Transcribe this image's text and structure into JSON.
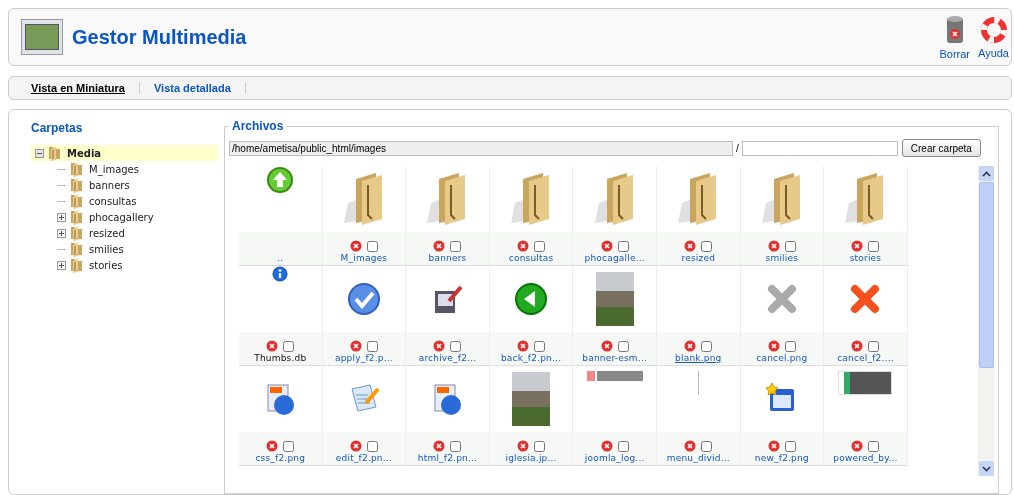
{
  "header": {
    "title": "Gestor Multimedia",
    "actions": [
      {
        "label": "Borrar",
        "kind": "delete"
      },
      {
        "label": "Ayuda",
        "kind": "help"
      }
    ]
  },
  "tabs": [
    {
      "label": "Vista en Miniatura",
      "selected": true
    },
    {
      "label": "Vista detallada",
      "selected": false
    }
  ],
  "folders": {
    "title": "Carpetas",
    "tree": [
      {
        "label": "Media",
        "kind": "branch",
        "expanded": true,
        "selected": true,
        "children": [
          {
            "label": "M_images",
            "kind": "leaf",
            "selected": false
          },
          {
            "label": "banners",
            "kind": "leaf",
            "selected": false
          },
          {
            "label": "consultas",
            "kind": "leaf",
            "selected": false
          },
          {
            "label": "phocagallery",
            "kind": "branch",
            "expanded": false,
            "selected": false
          },
          {
            "label": "resized",
            "kind": "branch",
            "expanded": false,
            "selected": false
          },
          {
            "label": "smilies",
            "kind": "leaf",
            "selected": false
          },
          {
            "label": "stories",
            "kind": "branch",
            "expanded": false,
            "selected": false
          }
        ]
      }
    ]
  },
  "files": {
    "title": "Archivos",
    "path": "/home/ametisa/public_html/images",
    "separator": "/",
    "create_button": "Crear carpeta",
    "items": [
      {
        "name": "..",
        "kind": "up"
      },
      {
        "name": "M_images",
        "kind": "folder",
        "checked": false,
        "hovered": false
      },
      {
        "name": "banners",
        "kind": "folder",
        "checked": false,
        "hovered": false
      },
      {
        "name": "consultas",
        "kind": "folder",
        "checked": false,
        "hovered": false
      },
      {
        "name": "phocagalle...",
        "kind": "folder",
        "checked": false,
        "hovered": false
      },
      {
        "name": "resized",
        "kind": "folder",
        "checked": false,
        "hovered": false
      },
      {
        "name": "smilies",
        "kind": "folder",
        "checked": false,
        "hovered": false
      },
      {
        "name": "stories",
        "kind": "folder",
        "checked": false,
        "hovered": false
      },
      {
        "name": "Thumbs.db",
        "kind": "doc",
        "checked": false,
        "hovered": false
      },
      {
        "name": "apply_f2.p...",
        "kind": "image",
        "checked": false,
        "hovered": false
      },
      {
        "name": "archive_f2...",
        "kind": "image",
        "checked": false,
        "hovered": false
      },
      {
        "name": "back_f2.pn...",
        "kind": "image",
        "checked": false,
        "hovered": false
      },
      {
        "name": "banner-esm...",
        "kind": "photo",
        "checked": false,
        "hovered": false
      },
      {
        "name": "blank.png",
        "kind": "image",
        "checked": false,
        "hovered": true
      },
      {
        "name": "cancel.png",
        "kind": "image",
        "checked": false,
        "hovered": false
      },
      {
        "name": "cancel_f2....",
        "kind": "image",
        "checked": false,
        "hovered": false
      },
      {
        "name": "css_f2.png",
        "kind": "image",
        "checked": false,
        "hovered": false
      },
      {
        "name": "edit_f2.pn...",
        "kind": "image",
        "checked": false,
        "hovered": false
      },
      {
        "name": "html_f2.pn...",
        "kind": "image",
        "checked": false,
        "hovered": false
      },
      {
        "name": "iglesia.jp...",
        "kind": "photo",
        "checked": false,
        "hovered": false
      },
      {
        "name": "joomla_log...",
        "kind": "image",
        "checked": false,
        "hovered": false
      },
      {
        "name": "menu_divid...",
        "kind": "image",
        "checked": false,
        "hovered": false
      },
      {
        "name": "new_f2.png",
        "kind": "image",
        "checked": false,
        "hovered": false
      },
      {
        "name": "powered_by...",
        "kind": "image",
        "checked": false,
        "hovered": false
      }
    ]
  }
}
